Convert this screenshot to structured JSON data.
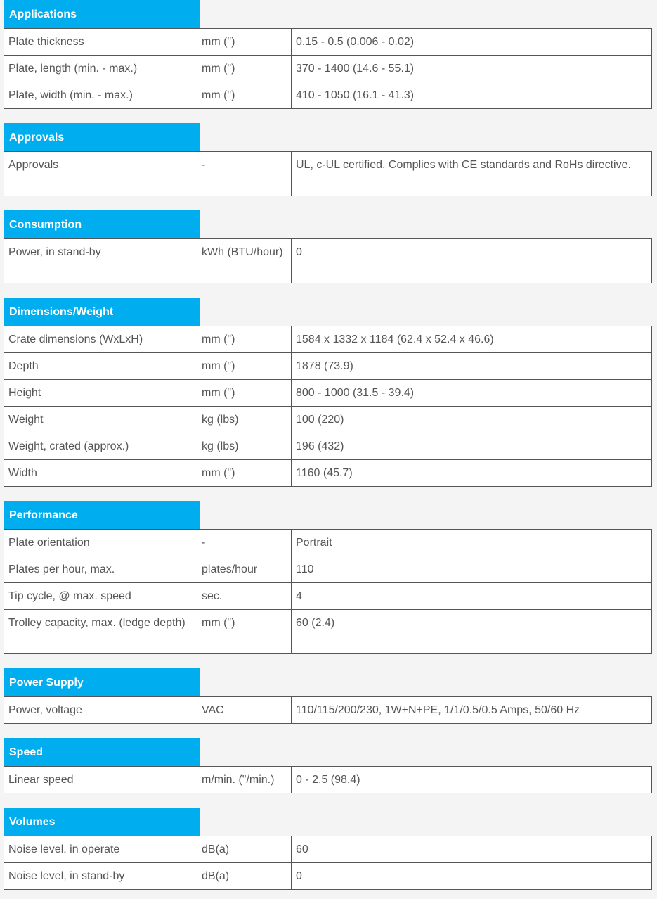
{
  "sections": [
    {
      "title": "Applications",
      "rows": [
        {
          "label": "Plate thickness",
          "unit": "mm (\")",
          "value": "0.15 - 0.5 (0.006 - 0.02)"
        },
        {
          "label": "Plate, length (min. - max.)",
          "unit": "mm (\")",
          "value": "370 - 1400 (14.6 - 55.1)"
        },
        {
          "label": "Plate, width (min. - max.)",
          "unit": "mm (\")",
          "value": "410 - 1050 (16.1 - 41.3)"
        }
      ]
    },
    {
      "title": "Approvals",
      "rows": [
        {
          "label": "Approvals",
          "unit": "-",
          "value": "UL, c-UL certified. Complies with CE standards and RoHs directive."
        }
      ]
    },
    {
      "title": "Consumption",
      "rows": [
        {
          "label": "Power, in stand-by",
          "unit": "kWh (BTU/hour)",
          "value": "0"
        }
      ]
    },
    {
      "title": "Dimensions/Weight",
      "rows": [
        {
          "label": "Crate dimensions (WxLxH)",
          "unit": "mm (\")",
          "value": "1584 x 1332 x 1184 (62.4 x 52.4 x 46.6)"
        },
        {
          "label": "Depth",
          "unit": "mm (\")",
          "value": "1878 (73.9)"
        },
        {
          "label": "Height",
          "unit": "mm (\")",
          "value": "800 - 1000 (31.5 - 39.4)"
        },
        {
          "label": "Weight",
          "unit": "kg (lbs)",
          "value": "100 (220)"
        },
        {
          "label": "Weight, crated (approx.)",
          "unit": "kg (lbs)",
          "value": "196 (432)"
        },
        {
          "label": "Width",
          "unit": "mm (\")",
          "value": "1160 (45.7)"
        }
      ]
    },
    {
      "title": "Performance",
      "rows": [
        {
          "label": "Plate orientation",
          "unit": "-",
          "value": "Portrait"
        },
        {
          "label": "Plates per hour, max.",
          "unit": "plates/hour",
          "value": "110"
        },
        {
          "label": "Tip cycle, @ max. speed",
          "unit": "sec.",
          "value": "4"
        },
        {
          "label": "Trolley capacity, max. (ledge depth)",
          "unit": "mm (\")",
          "value": "60 (2.4)"
        }
      ]
    },
    {
      "title": "Power Supply",
      "rows": [
        {
          "label": "Power, voltage",
          "unit": "VAC",
          "value": "110/115/200/230, 1W+N+PE, 1/1/0.5/0.5 Amps, 50/60 Hz"
        }
      ]
    },
    {
      "title": "Speed",
      "rows": [
        {
          "label": "Linear speed",
          "unit": "m/min. (\"/min.)",
          "value": "0 - 2.5 (98.4)"
        }
      ]
    },
    {
      "title": "Volumes",
      "rows": [
        {
          "label": "Noise level, in operate",
          "unit": "dB(a)",
          "value": "60"
        },
        {
          "label": "Noise level, in stand-by",
          "unit": "dB(a)",
          "value": "0"
        }
      ]
    }
  ],
  "colors": {
    "header_bg": "#00aeef",
    "header_text": "#ffffff",
    "page_bg": "#f4f4f4",
    "text": "#555555",
    "border": "#555555"
  }
}
